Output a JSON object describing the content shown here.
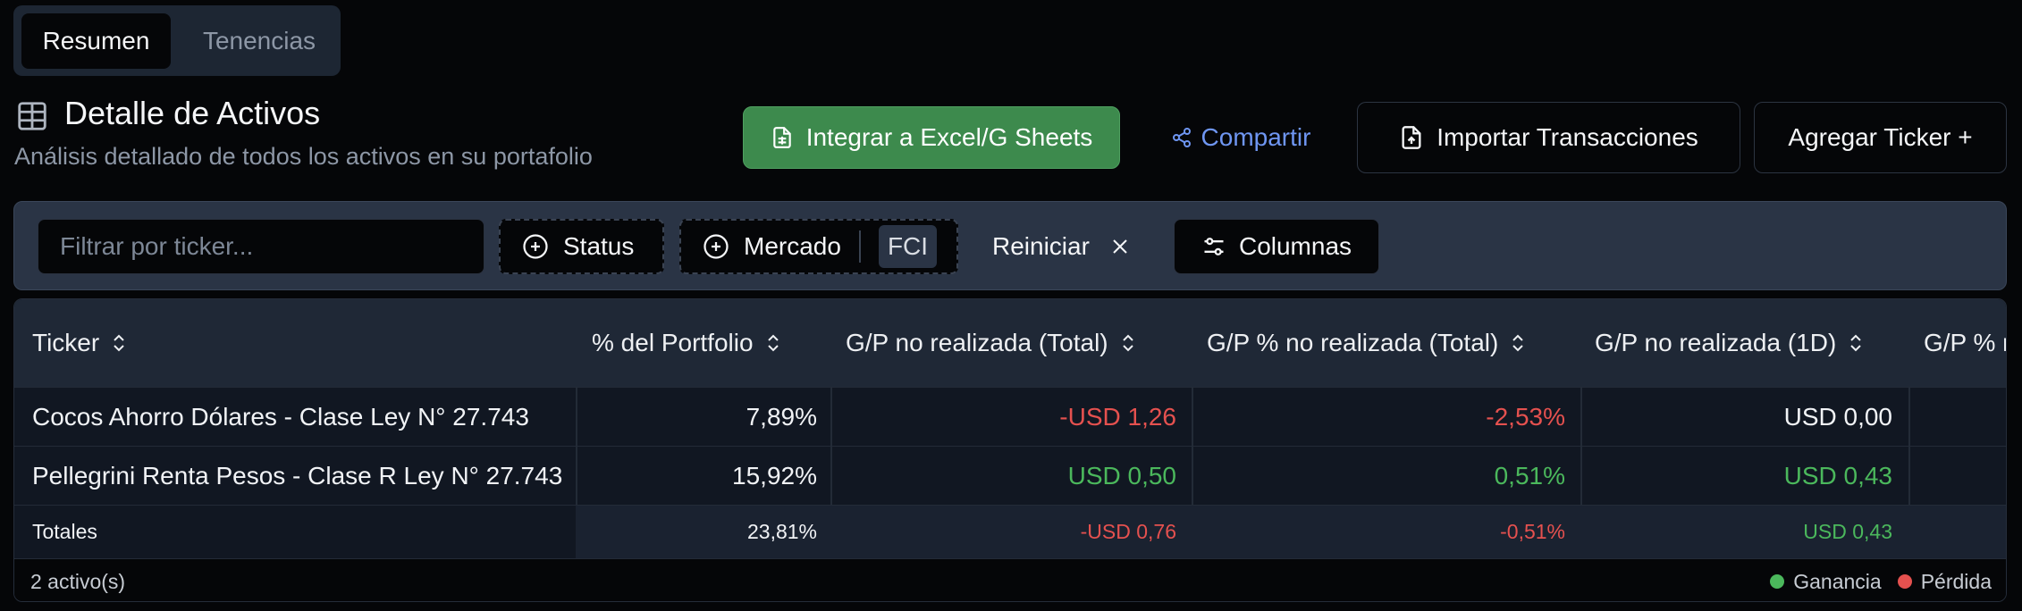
{
  "tabs": [
    {
      "label": "Resumen",
      "active": true
    },
    {
      "label": "Tenencias",
      "active": false
    }
  ],
  "header": {
    "title": "Detalle de Activos",
    "subtitle": "Análisis detallado de todos los activos en su portafolio",
    "icon": "table-icon"
  },
  "actions": {
    "excel_label": "Integrar a Excel/G Sheets",
    "share_label": "Compartir",
    "import_label": "Importar Transacciones",
    "add_label": "Agregar Ticker +"
  },
  "filters": {
    "search_placeholder": "Filtrar por ticker...",
    "status_label": "Status",
    "market_label": "Mercado",
    "market_selected": "FCI",
    "reset_label": "Reiniciar",
    "columns_label": "Columnas"
  },
  "table": {
    "columns": [
      "Ticker",
      "% del Portfolio",
      "G/P no realizada (Total)",
      "G/P % no realizada (Total)",
      "G/P no realizada (1D)",
      "G/P % r"
    ],
    "rows": [
      {
        "ticker": "Cocos Ahorro Dólares - Clase Ley N° 27.743",
        "portfolio_pct": "7,89%",
        "gp_total": "-USD 1,26",
        "gp_pct_total": "-2,53%",
        "gp_1d": "USD 0,00"
      },
      {
        "ticker": "Pellegrini Renta Pesos - Clase R Ley N° 27.743",
        "portfolio_pct": "15,92%",
        "gp_total": "USD 0,50",
        "gp_pct_total": "0,51%",
        "gp_1d": "USD 0,43"
      }
    ],
    "totals": {
      "label": "Totales",
      "portfolio_pct": "23,81%",
      "gp_total": "-USD 0,76",
      "gp_pct_total": "-0,51%",
      "gp_1d": "USD 0,43"
    },
    "footer": {
      "count": "2 activo(s)",
      "legend_gain": "Ganancia",
      "legend_loss": "Pérdida"
    }
  },
  "colors": {
    "gain": "#4bb85c",
    "loss": "#e5514f",
    "accent_green": "#3d8a4d",
    "link_blue": "#6f96f2"
  }
}
